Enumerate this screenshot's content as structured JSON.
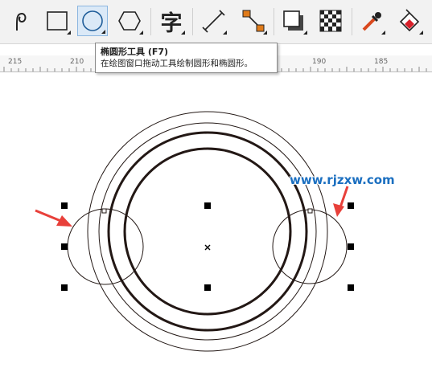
{
  "toolbar": {
    "tools": [
      {
        "name": "freehand-tool",
        "icon": "freehand-curve-icon",
        "active": false
      },
      {
        "name": "rectangle-tool",
        "icon": "rectangle-icon",
        "active": false
      },
      {
        "name": "ellipse-tool",
        "icon": "ellipse-icon",
        "active": true
      },
      {
        "name": "polygon-tool",
        "icon": "hexagon-icon",
        "active": false
      },
      {
        "name": "text-tool",
        "icon": "text-character-icon",
        "glyph": "字",
        "active": false
      },
      {
        "name": "dimension-tool",
        "icon": "dimension-line-icon",
        "active": false
      },
      {
        "name": "connector-tool",
        "icon": "connector-icon",
        "active": false
      },
      {
        "name": "drop-shadow-tool",
        "icon": "drop-shadow-icon",
        "active": false
      },
      {
        "name": "transparency-tool",
        "icon": "checkerboard-icon",
        "active": false
      },
      {
        "name": "eyedropper-tool",
        "icon": "eyedropper-icon",
        "active": false
      },
      {
        "name": "interactive-fill-tool",
        "icon": "fill-bucket-icon",
        "active": false
      }
    ]
  },
  "tooltip": {
    "title": "椭圆形工具 (F7)",
    "description": "在绘图窗口拖动工具绘制圆形和椭圆形。"
  },
  "ruler": {
    "labels": [
      "215",
      "210",
      "190",
      "185"
    ]
  },
  "watermark": "www.rjzxw.com",
  "colors": {
    "active_tool_bg": "#dbe9f7",
    "active_tool_border": "#8bb6e0",
    "arrow_red": "#e8403a",
    "watermark_blue": "#1b6fc0",
    "stroke": "#231815",
    "connector_orange": "#e07b1a"
  }
}
